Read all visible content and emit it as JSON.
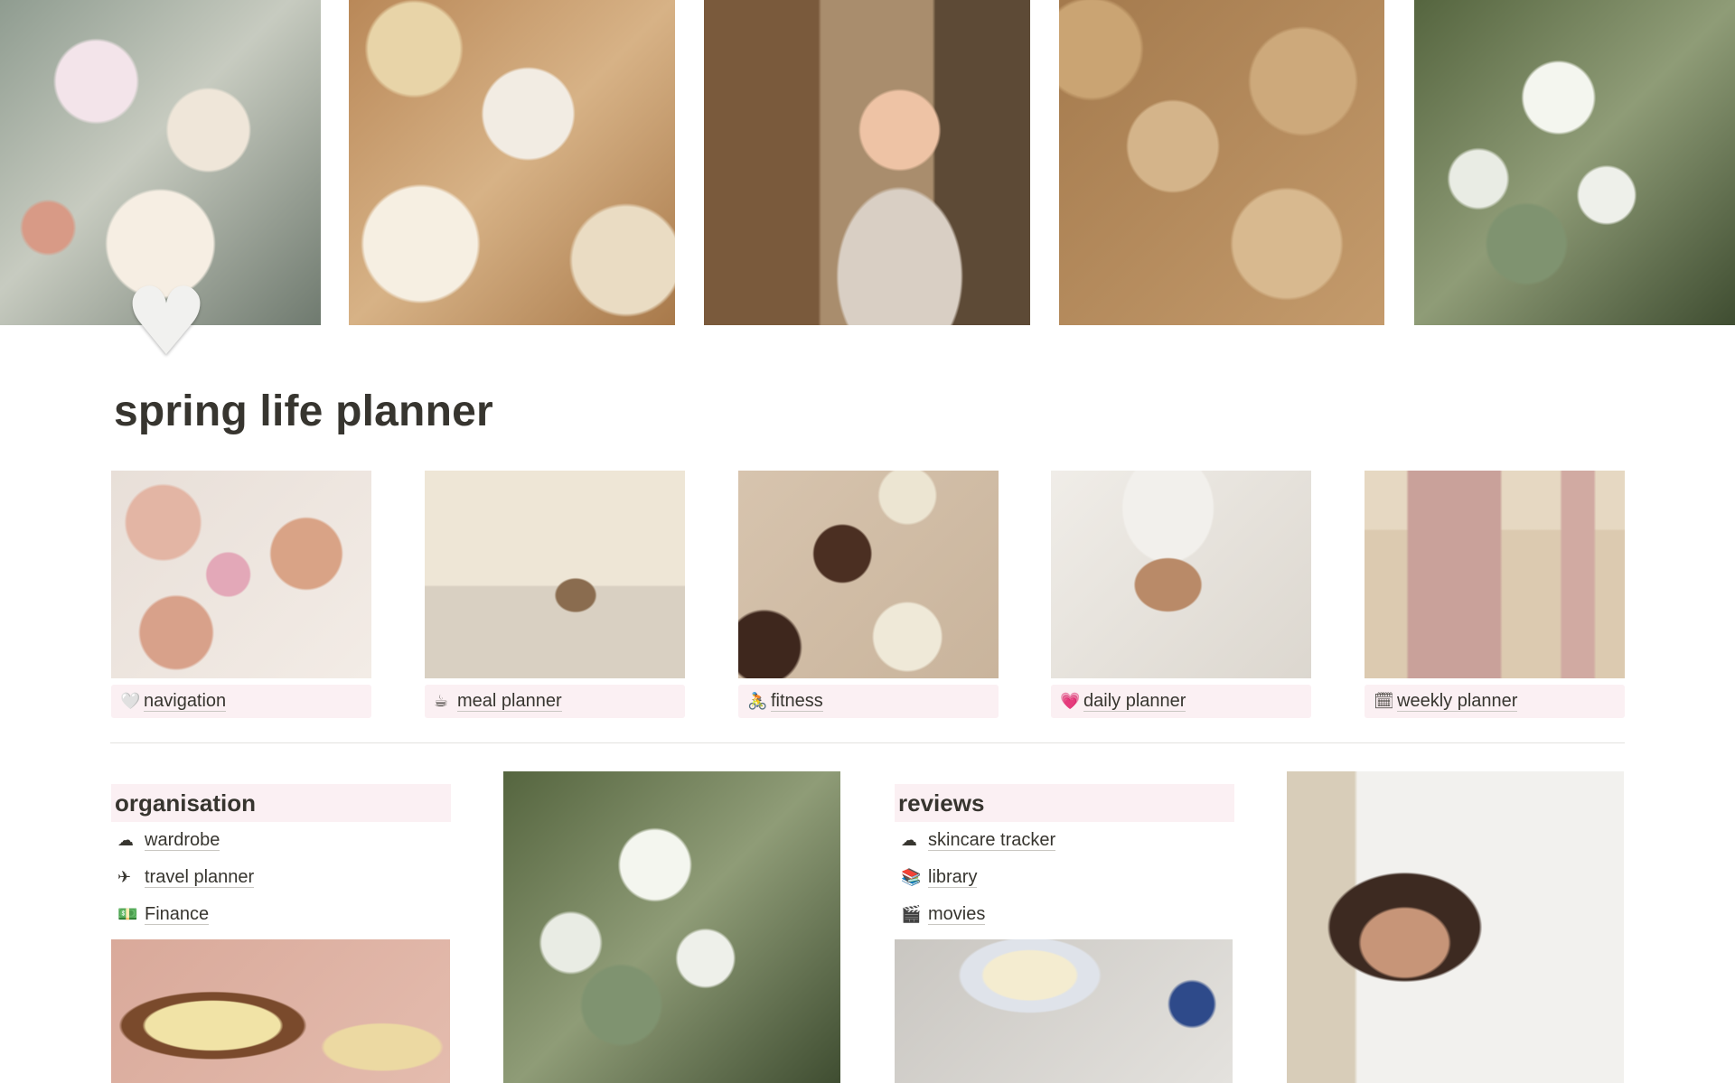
{
  "page": {
    "title": "spring life planner",
    "heart_icon": "white-heart-icon",
    "heart_glyph": "♥"
  },
  "gallery": [
    {
      "label": "navigation",
      "emoji": "🤍",
      "icon": "white-heart-icon"
    },
    {
      "label": "meal planner",
      "emoji": "☕",
      "icon": "coffee-icon"
    },
    {
      "label": "fitness",
      "emoji": "🚴",
      "icon": "bicycle-icon"
    },
    {
      "label": "daily planner",
      "emoji": "💗",
      "icon": "pink-heart-icon"
    },
    {
      "label": "weekly planner",
      "emoji": "🗓",
      "icon": "calendar-icon"
    }
  ],
  "organisation": {
    "heading": "organisation",
    "items": [
      {
        "label": "wardrobe",
        "emoji": "☁",
        "icon": "cloud-icon"
      },
      {
        "label": "travel planner",
        "emoji": "✈",
        "icon": "airplane-icon"
      },
      {
        "label": "Finance",
        "emoji": "💵",
        "icon": "money-icon"
      }
    ]
  },
  "reviews": {
    "heading": "reviews",
    "items": [
      {
        "label": "skincare tracker",
        "emoji": "☁",
        "icon": "cloud-icon"
      },
      {
        "label": "library",
        "emoji": "📚",
        "icon": "books-icon"
      },
      {
        "label": "movies",
        "emoji": "🎬",
        "icon": "clapper-icon"
      }
    ]
  },
  "colors": {
    "label_bg": "#fbf0f3",
    "text": "#37352f",
    "divider": "#e3e2e0"
  }
}
